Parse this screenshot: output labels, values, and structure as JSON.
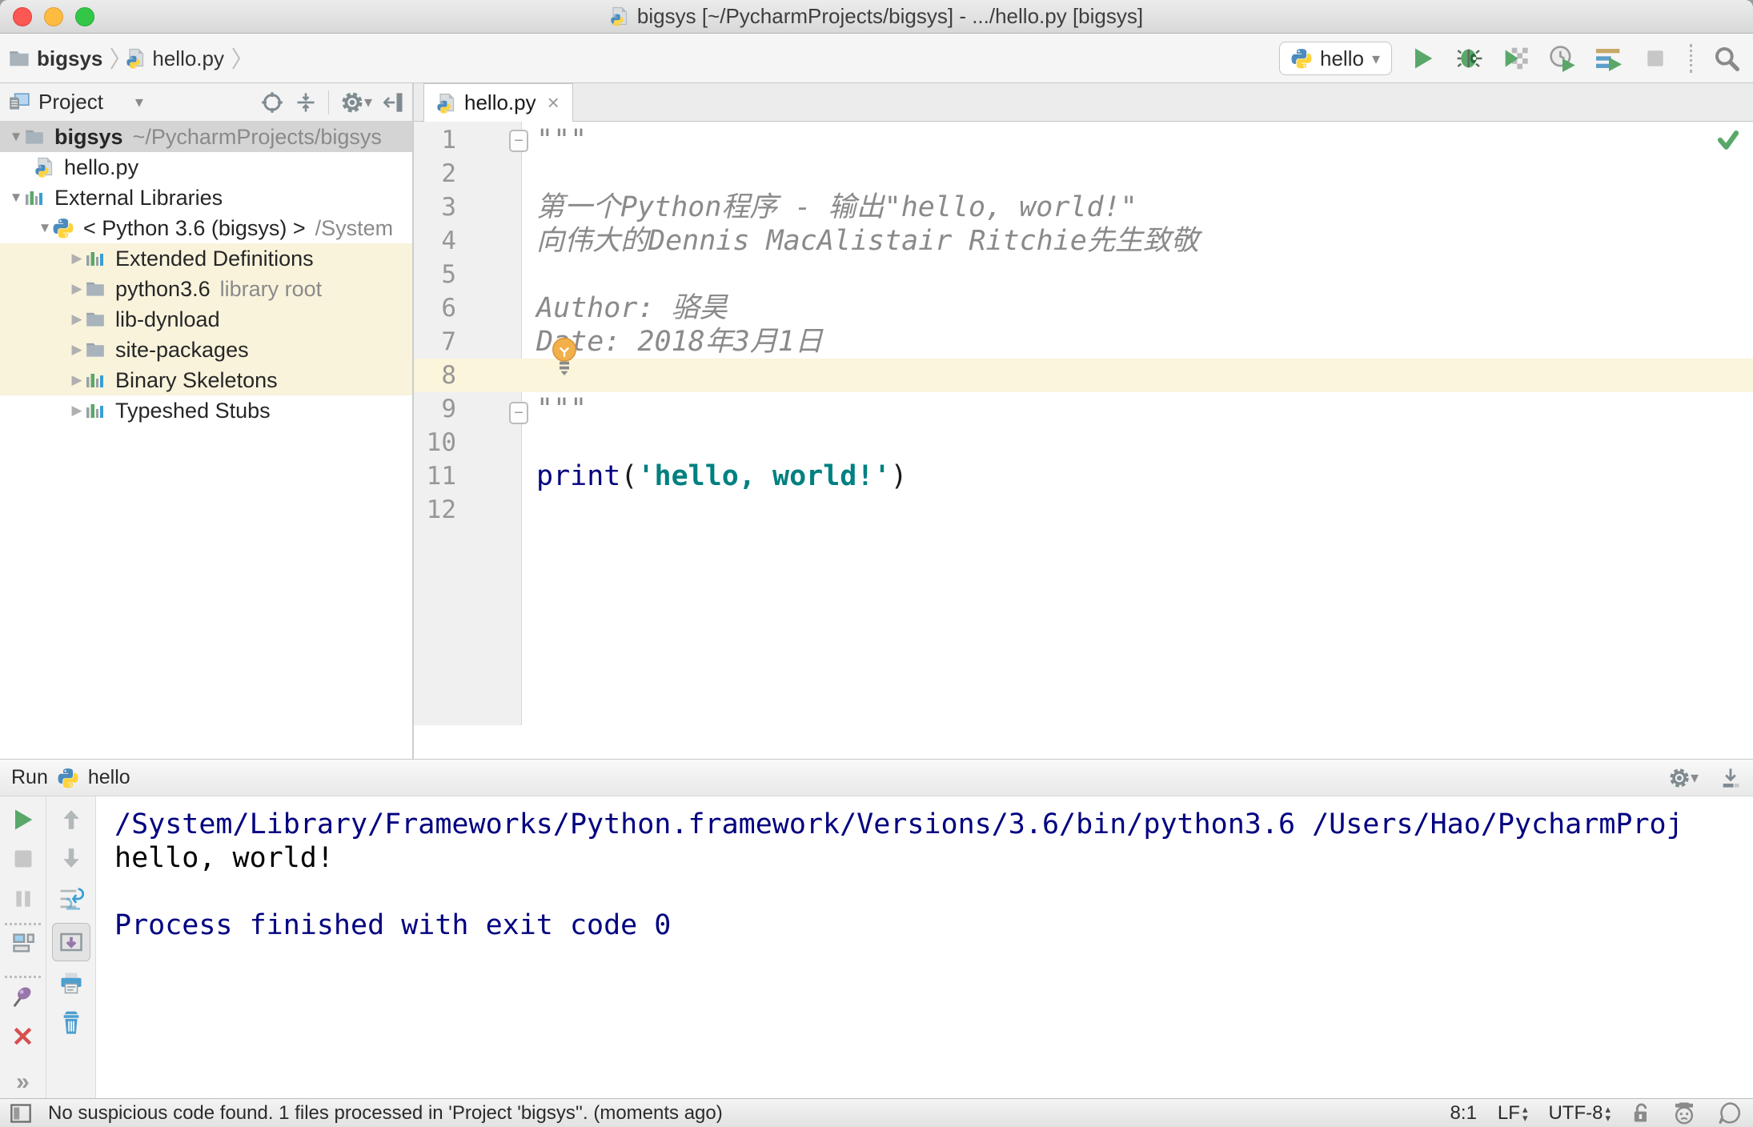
{
  "window": {
    "title": "bigsys [~/PycharmProjects/bigsys] - .../hello.py [bigsys]"
  },
  "navbar": {
    "breadcrumbs": {
      "project": "bigsys",
      "file": "hello.py"
    },
    "run_config": "hello"
  },
  "project_panel": {
    "title": "Project",
    "tree": [
      {
        "label": "bigsys",
        "path": "~/PycharmProjects/bigsys"
      },
      {
        "label": "hello.py"
      },
      {
        "label": "External Libraries"
      },
      {
        "label": "< Python 3.6 (bigsys) >",
        "path": "/System"
      },
      {
        "label": "Extended Definitions"
      },
      {
        "label": "python3.6",
        "suffix": "library root"
      },
      {
        "label": "lib-dynload"
      },
      {
        "label": "site-packages"
      },
      {
        "label": "Binary Skeletons"
      },
      {
        "label": "Typeshed Stubs"
      }
    ]
  },
  "editor": {
    "tab": "hello.py",
    "line_numbers": [
      "1",
      "2",
      "3",
      "4",
      "5",
      "6",
      "7",
      "8",
      "9",
      "10",
      "11",
      "12"
    ],
    "docstring": {
      "open": "\"\"\"",
      "line3": "第一个Python程序 - 输出\"hello, world!\"",
      "line4": "向伟大的Dennis MacAlistair Ritchie先生致敬",
      "line6": "Author: 骆昊",
      "line7": "Date: 2018年3月1日",
      "close": "\"\"\""
    },
    "code": {
      "keyword": "print",
      "paren_open": "(",
      "string": "'hello, world!'",
      "paren_close": ")"
    }
  },
  "run_panel": {
    "label": "Run",
    "config": "hello",
    "console": {
      "line1": "/System/Library/Frameworks/Python.framework/Versions/3.6/bin/python3.6 /Users/Hao/PycharmProj",
      "line2": "hello, world!",
      "line4": "Process finished with exit code 0"
    }
  },
  "status_bar": {
    "message": "No suspicious code found. 1 files processed in 'Project 'bigsys''. (moments ago)",
    "caret": "8:1",
    "line_separator": "LF",
    "encoding": "UTF-8"
  },
  "icons": {
    "tab_close": "×",
    "more_chevrons": "»",
    "dropdown_caret": "▾",
    "tree_expanded": "▼",
    "tree_collapsed": "▶",
    "crumb_sep": "⟩",
    "spin_up": "▴",
    "spin_down": "▾"
  },
  "colors": {
    "run_green": "#59A869",
    "keyword_navy": "#000080",
    "string_teal": "#008080",
    "console_system_navy": "#000080",
    "tree_highlight": "#F9F3DC",
    "caret_line": "#FBF5DC",
    "selection_gray": "#D4D4D4",
    "close_red": "#D64F4F",
    "pin_purple": "#9876AA",
    "tool_blue": "#389FD6"
  }
}
